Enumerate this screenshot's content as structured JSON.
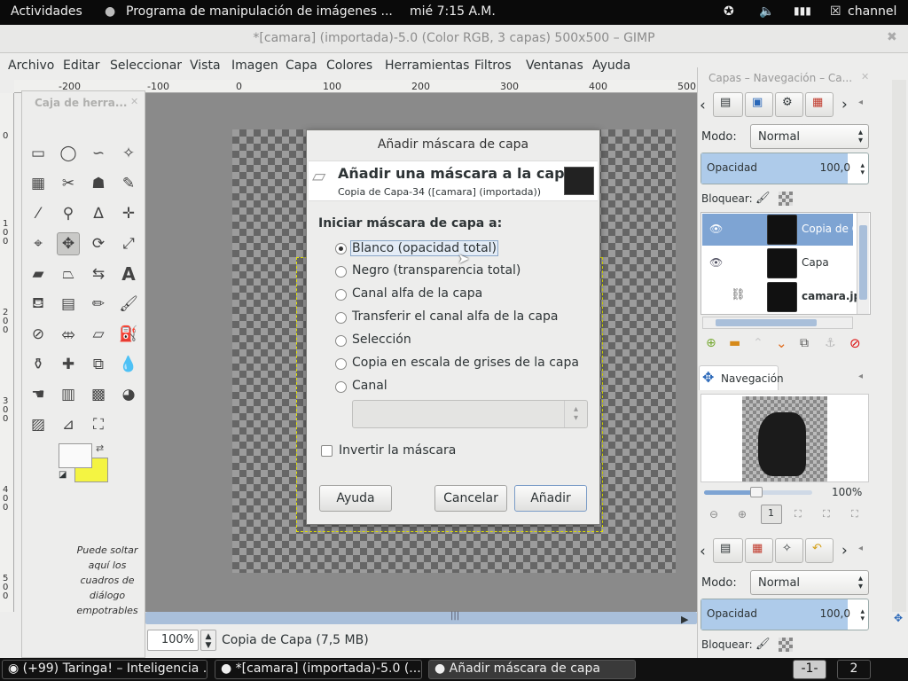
{
  "topbar": {
    "activities": "Actividades",
    "app_title": "Programa de manipulación de imágenes ...",
    "clock": "mié  7:15 A.M.",
    "user": "channel"
  },
  "window": {
    "title": "*[camara] (importada)-5.0 (Color RGB, 3 capas) 500x500 – GIMP"
  },
  "menubar": {
    "items": [
      "Archivo",
      "Editar",
      "Seleccionar",
      "Vista",
      "Imagen",
      "Capa",
      "Colores",
      "Herramientas",
      "Filtros",
      "Ventanas",
      "Ayuda"
    ]
  },
  "ruler": {
    "top_ticks": [
      "-200",
      "-100",
      "0",
      "100",
      "200",
      "300",
      "400",
      "500"
    ],
    "left_ticks": [
      "0",
      "100",
      "200",
      "300",
      "400",
      "500"
    ]
  },
  "toolbox": {
    "title": "Caja de herra...",
    "drop_hint": "Puede soltar aquí los cuadros de diálogo empotrables"
  },
  "statusbar": {
    "zoom": "100%",
    "info": "Copia de Capa (7,5 MB)"
  },
  "layers_dock": {
    "title": "Capas – Navegación – Ca...",
    "mode_label": "Modo:",
    "mode_value": "Normal",
    "opacity_label": "Opacidad",
    "opacity_value": "100,0",
    "opacity_fraction": 1.0,
    "lock_label": "Bloquear:",
    "layers": [
      {
        "name": "Copia de C",
        "selected": true,
        "visible": true
      },
      {
        "name": "Capa",
        "selected": false,
        "visible": true
      },
      {
        "name": "camara.jpg",
        "selected": false,
        "visible": false
      }
    ]
  },
  "navigation": {
    "title": "Navegación",
    "zoom": "100%"
  },
  "bottom_dock": {
    "mode_label": "Modo:",
    "mode_value": "Normal",
    "opacity_label": "Opacidad",
    "opacity_value": "100,0",
    "lock_label": "Bloquear:"
  },
  "dialog": {
    "title": "Añadir máscara de capa",
    "heading": "Añadir una máscara a la capa",
    "subheading": "Copia de Capa-34 ([camara] (importada))",
    "section": "Iniciar máscara de capa a:",
    "options": [
      "Blanco (opacidad total)",
      "Negro (transparencia total)",
      "Canal alfa de la capa",
      "Transferir el canal alfa de la capa",
      "Selección",
      "Copia en escala de grises de la capa",
      "Canal"
    ],
    "selected_index": 0,
    "invert_label": "Invertir la máscara",
    "help": "Ayuda",
    "cancel": "Cancelar",
    "add": "Añadir"
  },
  "taskbar": {
    "tasks": [
      "(+99) Taringa! – Inteligencia ...",
      "*[camara] (importada)-5.0 (...",
      "Añadir máscara de capa"
    ],
    "workspace_1": "-1-",
    "workspace_2": "2"
  }
}
